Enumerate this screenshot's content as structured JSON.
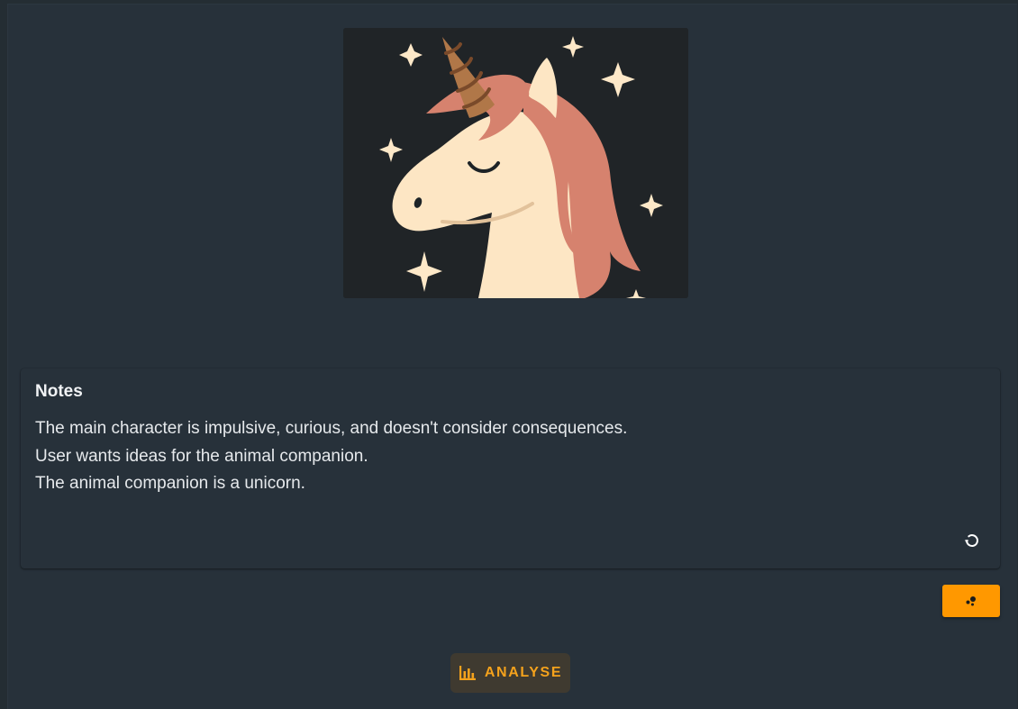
{
  "image": {
    "alt": "unicorn-illustration"
  },
  "notes": {
    "title": "Notes",
    "lines": [
      "The main character is impulsive, curious, and doesn't consider consequences.",
      "User wants ideas for the animal companion.",
      "The animal companion is a unicorn."
    ],
    "reset_icon": "refresh-icon"
  },
  "action_button": {
    "icon": "bubbles-icon",
    "color": "#ff9800"
  },
  "analyse_button": {
    "label": "ANALYSE",
    "icon": "bar-chart-icon",
    "color": "#f5a21c"
  }
}
